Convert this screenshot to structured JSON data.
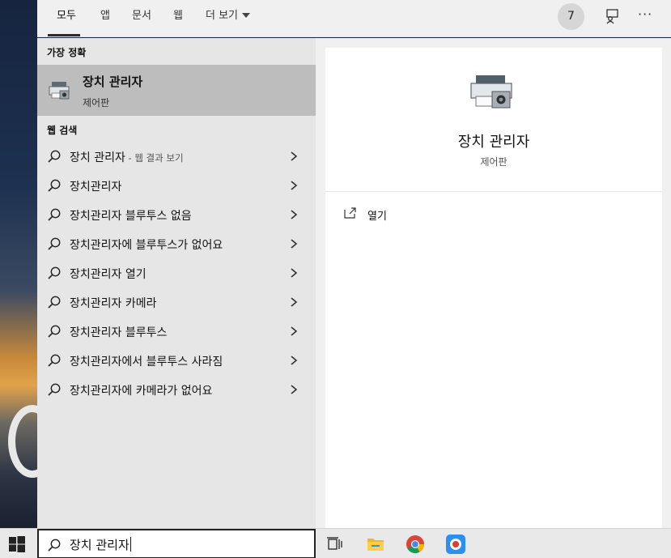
{
  "tabs": {
    "all": "모두",
    "apps": "앱",
    "documents": "문서",
    "web": "웹",
    "more": "더 보기"
  },
  "header": {
    "rewards_count": "7",
    "feedback_icon": "feedback-icon",
    "more_icon": "ellipsis-icon",
    "more_glyph": "···"
  },
  "best_match": {
    "heading": "가장 정확",
    "title": "장치 관리자",
    "subtitle": "제어판",
    "icon": "device-manager-icon"
  },
  "web_search": {
    "heading": "웹 검색",
    "items": [
      {
        "text": "장치 관리자",
        "suffix": " - 웹 결과 보기"
      },
      {
        "text": "장치관리자",
        "suffix": ""
      },
      {
        "text": "장치관리자 블루투스 없음",
        "suffix": ""
      },
      {
        "text": "장치관리자에 블루투스가 없어요",
        "suffix": ""
      },
      {
        "text": "장치관리자 열기",
        "suffix": ""
      },
      {
        "text": "장치관리자 카메라",
        "suffix": ""
      },
      {
        "text": "장치관리자 블루투스",
        "suffix": ""
      },
      {
        "text": "장치관리자에서 블루투스 사라짐",
        "suffix": ""
      },
      {
        "text": "장치관리자에 카메라가 없어요",
        "suffix": ""
      }
    ]
  },
  "preview": {
    "title": "장치 관리자",
    "subtitle": "제어판",
    "open_label": "열기"
  },
  "taskbar": {
    "query": "장치 관리자",
    "icons": [
      "windows-start-icon",
      "task-view-icon",
      "file-explorer-icon",
      "chrome-icon",
      "screen-recorder-icon"
    ]
  },
  "colors": {
    "selected_bg": "#bdbdbd",
    "pane_bg": "#e6e6e6",
    "card_bg": "#ffffff",
    "taskbar_bg": "#e9e9e9"
  }
}
